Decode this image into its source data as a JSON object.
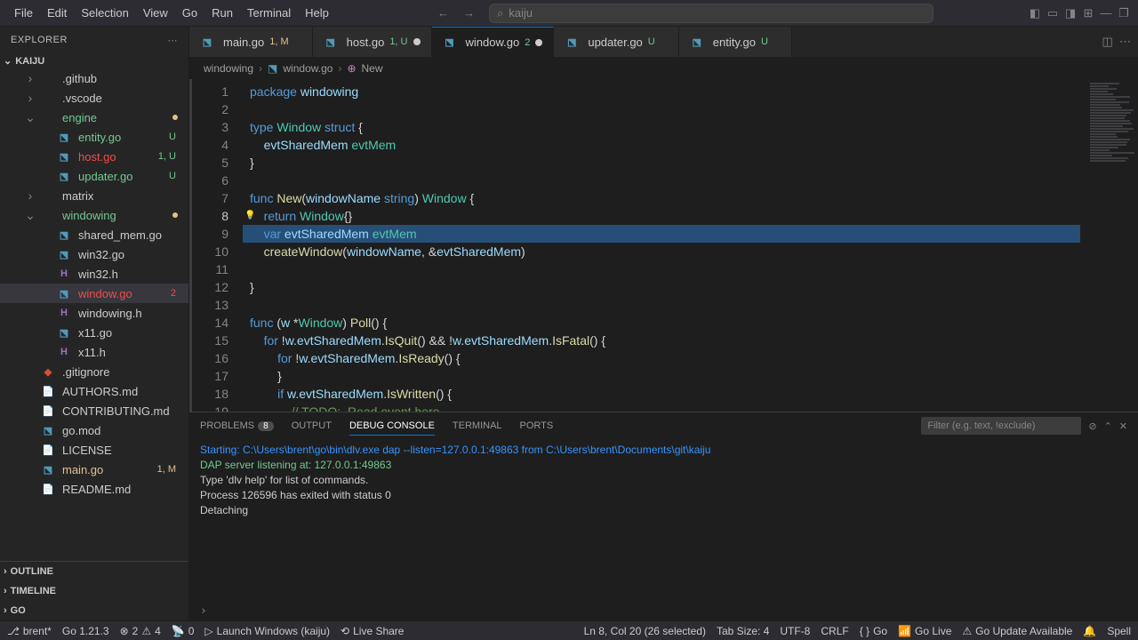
{
  "menu": {
    "items": [
      "File",
      "Edit",
      "Selection",
      "View",
      "Go",
      "Run",
      "Terminal",
      "Help"
    ]
  },
  "search": {
    "placeholder": "kaiju"
  },
  "explorer": {
    "title": "EXPLORER"
  },
  "project": {
    "name": "KAIJU"
  },
  "tree": [
    {
      "name": ".github",
      "type": "folder",
      "indent": 1
    },
    {
      "name": ".vscode",
      "type": "folder",
      "indent": 1
    },
    {
      "name": "engine",
      "type": "folder",
      "indent": 1,
      "expanded": true,
      "class": "engine-label",
      "dot": true
    },
    {
      "name": "entity.go",
      "type": "go",
      "indent": 2,
      "badge": "U",
      "class": "untracked"
    },
    {
      "name": "host.go",
      "type": "go",
      "indent": 2,
      "badge": "1, U",
      "class": "errored"
    },
    {
      "name": "updater.go",
      "type": "go",
      "indent": 2,
      "badge": "U",
      "class": "untracked"
    },
    {
      "name": "matrix",
      "type": "folder",
      "indent": 1
    },
    {
      "name": "windowing",
      "type": "folder",
      "indent": 1,
      "expanded": true,
      "class": "engine-label",
      "dot": true
    },
    {
      "name": "shared_mem.go",
      "type": "go",
      "indent": 2
    },
    {
      "name": "win32.go",
      "type": "go",
      "indent": 2
    },
    {
      "name": "win32.h",
      "type": "h",
      "indent": 2
    },
    {
      "name": "window.go",
      "type": "go",
      "indent": 2,
      "badge": "2",
      "class": "errored",
      "active": true
    },
    {
      "name": "windowing.h",
      "type": "h",
      "indent": 2
    },
    {
      "name": "x11.go",
      "type": "go",
      "indent": 2
    },
    {
      "name": "x11.h",
      "type": "h",
      "indent": 2
    },
    {
      "name": ".gitignore",
      "type": "git",
      "indent": 1
    },
    {
      "name": "AUTHORS.md",
      "type": "md",
      "indent": 1
    },
    {
      "name": "CONTRIBUTING.md",
      "type": "md",
      "indent": 1
    },
    {
      "name": "go.mod",
      "type": "go",
      "indent": 1
    },
    {
      "name": "LICENSE",
      "type": "file",
      "indent": 1
    },
    {
      "name": "main.go",
      "type": "go",
      "indent": 1,
      "badge": "1, M",
      "class": "modified"
    },
    {
      "name": "README.md",
      "type": "md",
      "indent": 1
    }
  ],
  "sections": {
    "outline": "OUTLINE",
    "timeline": "TIMELINE",
    "go": "GO"
  },
  "tabs": [
    {
      "label": "main.go",
      "status": "1, M",
      "statusClass": "mod"
    },
    {
      "label": "host.go",
      "status": "1, U",
      "dirty": true
    },
    {
      "label": "window.go",
      "status": "2",
      "dirty": true,
      "active": true
    },
    {
      "label": "updater.go",
      "status": "U"
    },
    {
      "label": "entity.go",
      "status": "U"
    }
  ],
  "breadcrumbs": [
    "windowing",
    "window.go",
    "New"
  ],
  "code": {
    "lines": [
      {
        "n": 1,
        "html": "<span class='kw'>package</span> <span class='ident'>windowing</span>"
      },
      {
        "n": 2,
        "html": ""
      },
      {
        "n": 3,
        "html": "<span class='kw'>type</span> <span class='type'>Window</span> <span class='kw'>struct</span> <span class='punct'>{</span>"
      },
      {
        "n": 4,
        "html": "    <span class='ident'>evtSharedMem</span> <span class='type'>evtMem</span>"
      },
      {
        "n": 5,
        "html": "<span class='punct'>}</span>"
      },
      {
        "n": 6,
        "html": ""
      },
      {
        "n": 7,
        "html": "<span class='kw'>func</span> <span class='func'>New</span><span class='punct'>(</span><span class='ident'>windowName</span> <span class='str'>string</span><span class='punct'>)</span> <span class='type'>Window</span> <span class='punct'>{</span>"
      },
      {
        "n": 8,
        "html": "    <span class='kw'>return</span> <span class='type'>Window</span><span class='punct'>{}</span>",
        "current": true,
        "hint": true
      },
      {
        "n": 9,
        "html": "    <span class='kw'>var</span> <span class='ident'>evtSharedMem</span> <span class='type'>evtMem</span>",
        "sel": true
      },
      {
        "n": 10,
        "html": "    <span class='func'>createWindow</span><span class='punct'>(</span><span class='ident'>windowName</span><span class='punct'>,</span> <span class='op'>&</span><span class='ident'>evtSharedMem</span><span class='punct'>)</span>"
      },
      {
        "n": 11,
        "html": ""
      },
      {
        "n": 12,
        "html": "<span class='punct'>}</span>"
      },
      {
        "n": 13,
        "html": ""
      },
      {
        "n": 14,
        "html": "<span class='kw'>func</span> <span class='punct'>(</span><span class='ident'>w</span> <span class='op'>*</span><span class='type'>Window</span><span class='punct'>)</span> <span class='func'>Poll</span><span class='punct'>()</span> <span class='punct'>{</span>"
      },
      {
        "n": 15,
        "html": "    <span class='kw'>for</span> <span class='op'>!</span><span class='ident'>w</span><span class='punct'>.</span><span class='ident'>evtSharedMem</span><span class='punct'>.</span><span class='func'>IsQuit</span><span class='punct'>()</span> <span class='op'>&&</span> <span class='op'>!</span><span class='ident'>w</span><span class='punct'>.</span><span class='ident'>evtSharedMem</span><span class='punct'>.</span><span class='func'>IsFatal</span><span class='punct'>()</span> <span class='punct'>{</span>"
      },
      {
        "n": 16,
        "html": "        <span class='kw'>for</span> <span class='op'>!</span><span class='ident'>w</span><span class='punct'>.</span><span class='ident'>evtSharedMem</span><span class='punct'>.</span><span class='func'>IsReady</span><span class='punct'>()</span> <span class='punct'>{</span>"
      },
      {
        "n": 17,
        "html": "        <span class='punct'>}</span>"
      },
      {
        "n": 18,
        "html": "        <span class='kw'>if</span> <span class='ident'>w</span><span class='punct'>.</span><span class='ident'>evtSharedMem</span><span class='punct'>.</span><span class='func'>IsWritten</span><span class='punct'>()</span> <span class='punct'>{</span>"
      },
      {
        "n": 19,
        "html": "            <span class='comment'>// TODO:  Read event here</span>"
      }
    ]
  },
  "panel": {
    "tabs": {
      "problems": "PROBLEMS",
      "problems_count": "8",
      "output": "OUTPUT",
      "debug": "DEBUG CONSOLE",
      "terminal": "TERMINAL",
      "ports": "PORTS"
    },
    "filter_placeholder": "Filter (e.g. text, !exclude)",
    "output": [
      {
        "class": "o1",
        "text": "Starting: C:\\Users\\brent\\go\\bin\\dlv.exe dap --listen=127.0.0.1:49863 from C:\\Users\\brent\\Documents\\git\\kaiju"
      },
      {
        "class": "o2",
        "text": "DAP server listening at: 127.0.0.1:49863"
      },
      {
        "class": "",
        "text": "Type 'dlv help' for list of commands."
      },
      {
        "class": "",
        "text": "Process 126596 has exited with status 0"
      },
      {
        "class": "",
        "text": "Detaching"
      }
    ]
  },
  "status": {
    "branch": "brent*",
    "go_version": "Go 1.21.3",
    "errors": "2",
    "warnings": "4",
    "port": "0",
    "launch": "Launch Windows (kaiju)",
    "liveshare": "Live Share",
    "position": "Ln 8, Col 20 (26 selected)",
    "spaces": "Tab Size: 4",
    "encoding": "UTF-8",
    "eol": "CRLF",
    "lang": "Go",
    "golive": "Go Live",
    "update": "Go Update Available",
    "spell": "Spell"
  }
}
